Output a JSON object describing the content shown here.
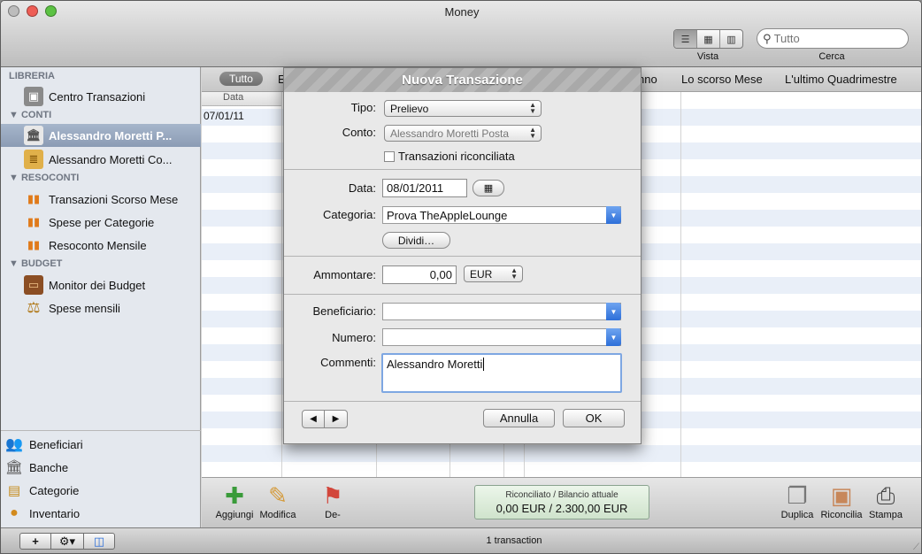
{
  "window": {
    "title": "Money"
  },
  "toolbar": {
    "view_label": "Vista",
    "view_icons": [
      "list-view-icon",
      "grid-view-icon",
      "cover-view-icon"
    ],
    "search_placeholder": "Tutto",
    "search_label": "Cerca"
  },
  "sidebar": {
    "libreria": {
      "heading": "LIBRERIA",
      "items": [
        {
          "label": "Centro Transazioni",
          "icon": "safe-icon"
        }
      ]
    },
    "conti": {
      "heading": "CONTI",
      "items": [
        {
          "label": "Alessandro Moretti P...",
          "icon": "bank-icon",
          "selected": true
        },
        {
          "label": "Alessandro Moretti Co...",
          "icon": "coins-icon",
          "selected": false
        }
      ]
    },
    "resoconti": {
      "heading": "RESOCONTI",
      "items": [
        {
          "label": "Transazioni Scorso Mese",
          "icon": "bar-chart-icon"
        },
        {
          "label": "Spese per Categorie",
          "icon": "bar-chart-icon"
        },
        {
          "label": "Resoconto Mensile",
          "icon": "bar-chart-icon"
        }
      ]
    },
    "budget": {
      "heading": "BUDGET",
      "items": [
        {
          "label": "Monitor dei Budget",
          "icon": "wallet-icon"
        },
        {
          "label": "Spese mensili",
          "icon": "scales-icon"
        }
      ]
    },
    "bottom_items": [
      {
        "label": "Beneficiari",
        "icon": "people-icon"
      },
      {
        "label": "Banche",
        "icon": "bank-icon"
      },
      {
        "label": "Categorie",
        "icon": "folders-icon"
      },
      {
        "label": "Inventario",
        "icon": "inventory-icon"
      }
    ]
  },
  "filters": {
    "all": "Tutto",
    "partial_left": "E",
    "partial_right": "nno",
    "last_month": "Lo scorso Mese",
    "last_quarter": "L'ultimo Quadrimestre"
  },
  "table": {
    "date_header": "Data",
    "rows": [
      {
        "date": "07/01/11"
      }
    ]
  },
  "actions": {
    "add": "Aggiungi",
    "edit": "Modifica",
    "flag": "De-",
    "duplicate": "Duplica",
    "reconcile": "Riconcilia",
    "print": "Stampa"
  },
  "reconciled": {
    "label": "Riconciliato / Bilancio attuale",
    "value": "0,00 EUR / 2.300,00 EUR"
  },
  "status": {
    "text": "1 transaction"
  },
  "dialog": {
    "title": "Nuova Transazione",
    "tipo_label": "Tipo:",
    "tipo_value": "Prelievo",
    "conto_label": "Conto:",
    "conto_value": "Alessandro Moretti Posta",
    "reconciled_checkbox": "Transazioni riconciliata",
    "reconciled_checked": false,
    "data_label": "Data:",
    "data_value": "08/01/2011",
    "categoria_label": "Categoria:",
    "categoria_value": "Prova TheAppleLounge",
    "dividi_button": "Dividi…",
    "ammontare_label": "Ammontare:",
    "ammontare_value": "0,00",
    "currency": "EUR",
    "beneficiario_label": "Beneficiario:",
    "beneficiario_value": "",
    "numero_label": "Numero:",
    "numero_value": "",
    "commenti_label": "Commenti:",
    "commenti_value": "Alessandro Moretti",
    "cancel_button": "Annulla",
    "ok_button": "OK"
  },
  "colors": {
    "selection": "#8b9cb4",
    "accent": "#2d6fd9",
    "close": "#ee5d55",
    "minimize": "#f4bc3b",
    "zoom": "#5cc243"
  }
}
